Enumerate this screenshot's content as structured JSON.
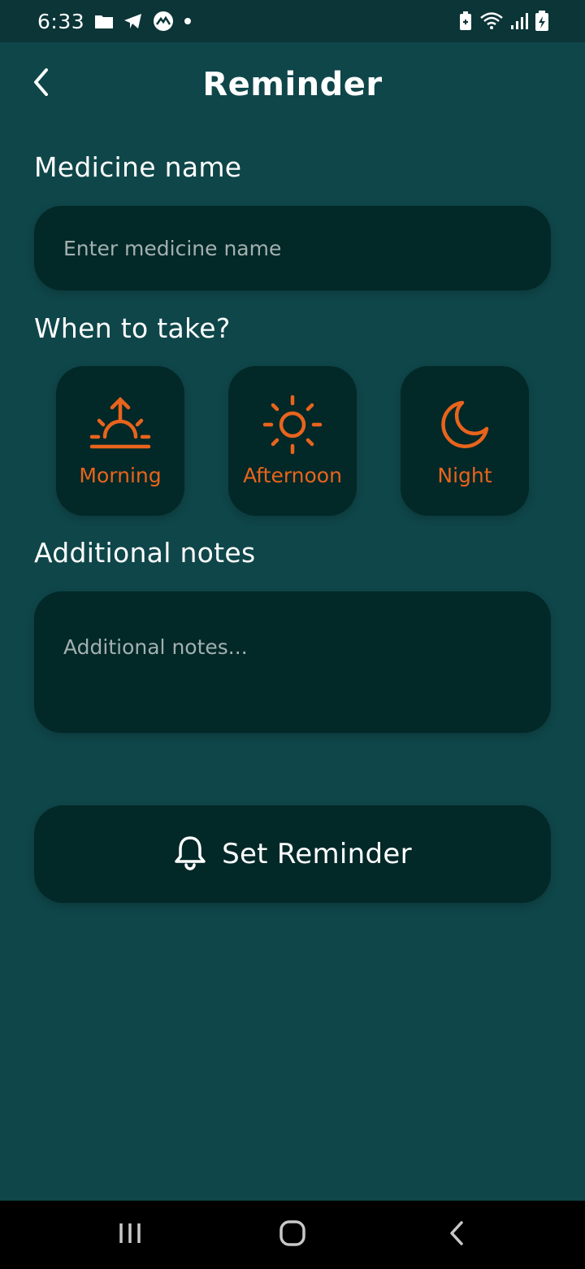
{
  "status_bar": {
    "time": "6:33",
    "icons": [
      "folder-icon",
      "telegram-icon",
      "app-icon",
      "dot-icon",
      "battery-saver-icon",
      "wifi-icon",
      "signal-icon",
      "battery-charging-icon"
    ]
  },
  "header": {
    "title": "Reminder",
    "back_icon": "chevron-left-icon"
  },
  "medicine": {
    "label": "Medicine name",
    "placeholder": "Enter medicine name",
    "value": ""
  },
  "when": {
    "label": "When to take?",
    "options": [
      {
        "label": "Morning",
        "icon": "sunrise-icon"
      },
      {
        "label": "Afternoon",
        "icon": "sun-icon"
      },
      {
        "label": "Night",
        "icon": "moon-icon"
      }
    ]
  },
  "notes": {
    "label": "Additional notes",
    "placeholder": "Additional notes...",
    "value": ""
  },
  "set_button": {
    "label": "Set Reminder",
    "icon": "bell-icon"
  },
  "nav": {
    "recents_icon": "recents-icon",
    "home_icon": "home-icon",
    "back_icon": "back-icon"
  },
  "colors": {
    "background": "#0f4649",
    "status_bar": "#0b3537",
    "card": "#022828",
    "accent": "#e8641c",
    "text": "#ffffff",
    "placeholder": "#a3b0b0"
  }
}
